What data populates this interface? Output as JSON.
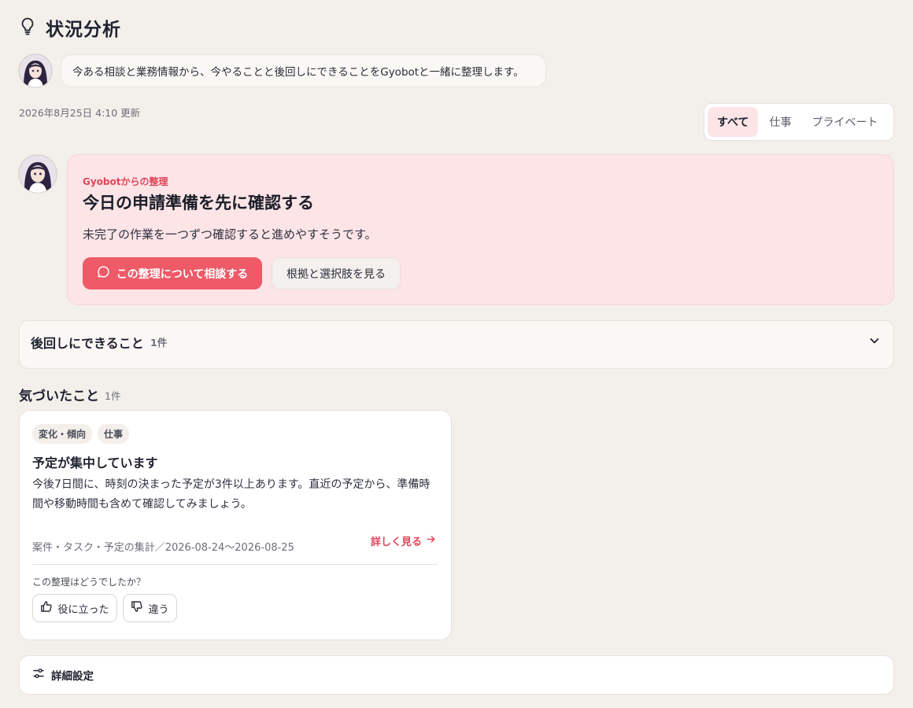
{
  "header": {
    "title": "状況分析",
    "icon": "lightbulb-icon"
  },
  "intro": {
    "message": "今ある相談と業務情報から、今やることと後回しにできることをGyobotと一緒に整理します。"
  },
  "updated_at": "2026年8月25日 4:10 更新",
  "filter_tabs": [
    {
      "label": "すべて",
      "active": true
    },
    {
      "label": "仕事",
      "active": false
    },
    {
      "label": "プライベート",
      "active": false
    }
  ],
  "summary": {
    "label": "Gyobotからの整理",
    "title": "今日の申請準備を先に確認する",
    "description": "未完了の作業を一つずつ確認すると進めやすそうです。",
    "primary_button": "この整理について相談する",
    "secondary_button": "根拠と選択肢を見る"
  },
  "postpone": {
    "title": "後回しにできること",
    "count": "1件"
  },
  "insights": {
    "heading": "気づいたこと",
    "count": "1件",
    "items": [
      {
        "tags": [
          "変化・傾向",
          "仕事"
        ],
        "title": "予定が集中しています",
        "description": "今後7日間に、時刻の決まった予定が3件以上あります。直近の予定から、準備時間や移動時間も含めて確認してみましょう。",
        "source": "案件・タスク・予定の集計／2026-08-24〜2026-08-25",
        "more_link": "詳しく見る",
        "feedback_question": "この整理はどうでしたか？",
        "helpful_label": "役に立った",
        "not_helpful_label": "違う"
      }
    ]
  },
  "settings": {
    "label": "詳細設定"
  },
  "colors": {
    "background": "#f3f0eb",
    "accent": "#ee5a68",
    "accent_text": "#e0455a",
    "summary_bg": "#fde4e6"
  }
}
